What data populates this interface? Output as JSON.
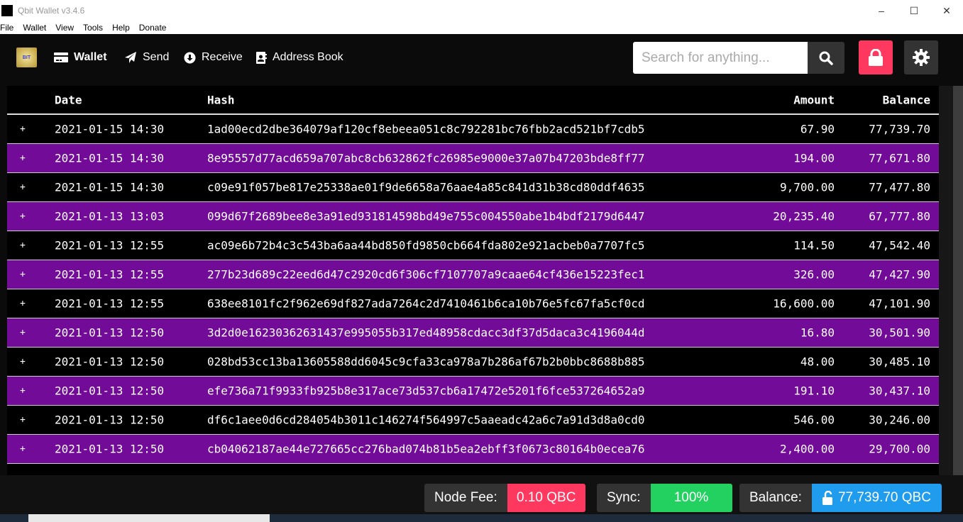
{
  "window": {
    "title": "Qbit Wallet v3.4.6"
  },
  "menu": [
    "File",
    "Wallet",
    "View",
    "Tools",
    "Help",
    "Donate"
  ],
  "nav": {
    "logo_text": "BIT",
    "items": [
      {
        "label": "Wallet",
        "icon": "credit-card-icon",
        "active": true
      },
      {
        "label": "Send",
        "icon": "paper-plane-icon"
      },
      {
        "label": "Receive",
        "icon": "download-circle-icon"
      },
      {
        "label": "Address Book",
        "icon": "address-book-icon"
      }
    ],
    "search_placeholder": "Search for anything..."
  },
  "colors": {
    "row_alt": "#720b98",
    "lock": "#ff3860",
    "fee": "#ff3860",
    "sync": "#23d160",
    "balance": "#209cee"
  },
  "table": {
    "headers": {
      "date": "Date",
      "hash": "Hash",
      "amount": "Amount",
      "balance": "Balance"
    },
    "rows": [
      {
        "expand": "+",
        "date": "2021-01-15 14:30",
        "hash": "1ad00ecd2dbe364079af120cf8ebeea051c8c792281bc76fbb2acd521bf7cdb5",
        "amount": "67.90",
        "balance": "77,739.70"
      },
      {
        "expand": "+",
        "date": "2021-01-15 14:30",
        "hash": "8e95557d77acd659a707abc8cb632862fc26985e9000e37a07b47203bde8ff77",
        "amount": "194.00",
        "balance": "77,671.80"
      },
      {
        "expand": "+",
        "date": "2021-01-15 14:30",
        "hash": "c09e91f057be817e25338ae01f9de6658a76aae4a85c841d31b38cd80ddf4635",
        "amount": "9,700.00",
        "balance": "77,477.80"
      },
      {
        "expand": "+",
        "date": "2021-01-13 13:03",
        "hash": "099d67f2689bee8e3a91ed931814598bd49e755c004550abe1b4bdf2179d6447",
        "amount": "20,235.40",
        "balance": "67,777.80"
      },
      {
        "expand": "+",
        "date": "2021-01-13 12:55",
        "hash": "ac09e6b72b4c3c543ba6aa44bd850fd9850cb664fda802e921acbeb0a7707fc5",
        "amount": "114.50",
        "balance": "47,542.40"
      },
      {
        "expand": "+",
        "date": "2021-01-13 12:55",
        "hash": "277b23d689c22eed6d47c2920cd6f306cf7107707a9caae64cf436e15223fec1",
        "amount": "326.00",
        "balance": "47,427.90"
      },
      {
        "expand": "+",
        "date": "2021-01-13 12:55",
        "hash": "638ee8101fc2f962e69df827ada7264c2d7410461b6ca10b76e5fc67fa5cf0cd",
        "amount": "16,600.00",
        "balance": "47,101.90"
      },
      {
        "expand": "+",
        "date": "2021-01-13 12:50",
        "hash": "3d2d0e16230362631437e995055b317ed48958cdacc3df37d5daca3c4196044d",
        "amount": "16.80",
        "balance": "30,501.90"
      },
      {
        "expand": "+",
        "date": "2021-01-13 12:50",
        "hash": "028bd53cc13ba13605588dd6045c9cfa33ca978a7b286af67b2b0bbc8688b885",
        "amount": "48.00",
        "balance": "30,485.10"
      },
      {
        "expand": "+",
        "date": "2021-01-13 12:50",
        "hash": "efe736a71f9933fb925b8e317ace73d537cb6a17472e5201f6fce537264652a9",
        "amount": "191.10",
        "balance": "30,437.10"
      },
      {
        "expand": "+",
        "date": "2021-01-13 12:50",
        "hash": "df6c1aee0d6cd284054b3011c146274f564997c5aaeadc42a6c7a91d3d8a0cd0",
        "amount": "546.00",
        "balance": "30,246.00"
      },
      {
        "expand": "+",
        "date": "2021-01-13 12:50",
        "hash": "cb04062187ae44e727665cc276bad074b81b5ea2ebff3f0673c80164b0ecea76",
        "amount": "2,400.00",
        "balance": "29,700.00"
      }
    ]
  },
  "footer": {
    "fee_label": "Node Fee:",
    "fee_value": "0.10 QBC",
    "sync_label": "Sync:",
    "sync_value": "100%",
    "balance_label": "Balance:",
    "balance_value": "77,739.70 QBC"
  }
}
